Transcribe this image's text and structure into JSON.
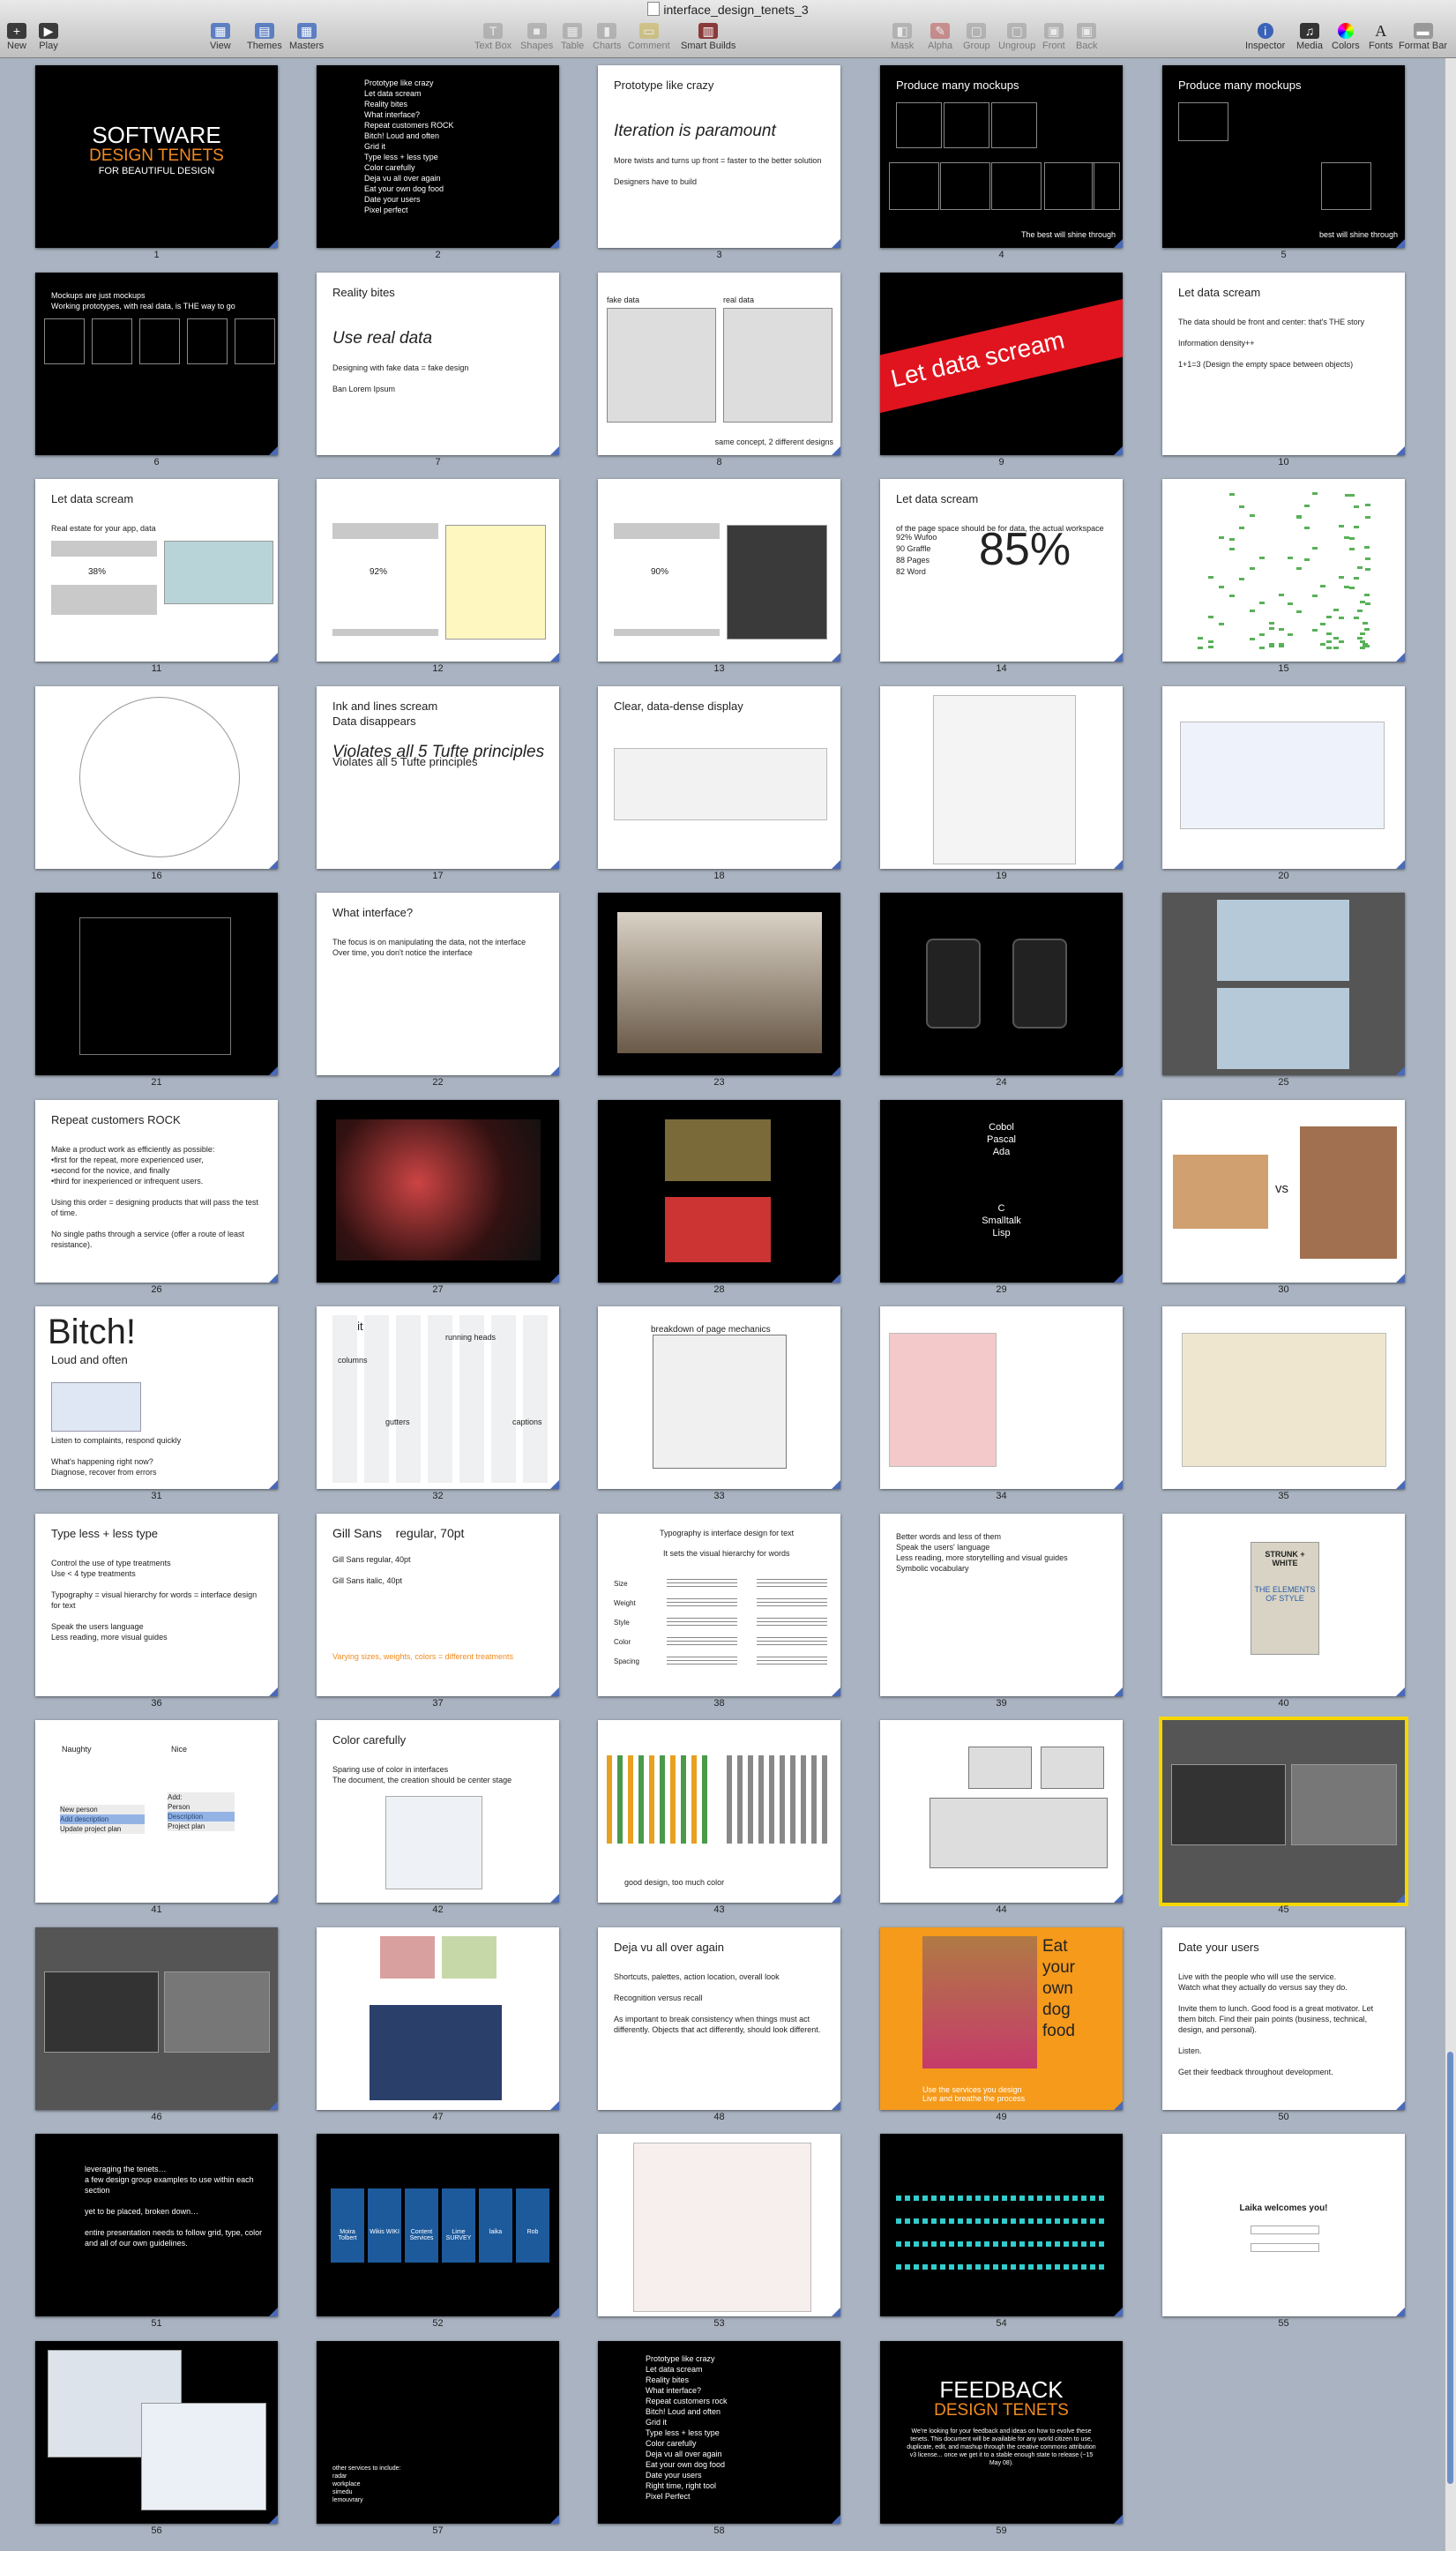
{
  "window": {
    "title": "interface_design_tenets_3"
  },
  "toolbar": {
    "new": "New",
    "play": "Play",
    "view": "View",
    "themes": "Themes",
    "masters": "Masters",
    "text_box": "Text Box",
    "shapes": "Shapes",
    "table": "Table",
    "charts": "Charts",
    "comment": "Comment",
    "smart_builds": "Smart Builds",
    "mask": "Mask",
    "alpha": "Alpha",
    "group": "Group",
    "ungroup": "Ungroup",
    "front": "Front",
    "back": "Back",
    "inspector": "Inspector",
    "media": "Media",
    "colors": "Colors",
    "fonts": "Fonts",
    "format_bar": "Format Bar"
  },
  "slides": [
    {
      "n": "1",
      "bg": "black",
      "big1": "SOFTWARE",
      "big2": "DESIGN TENETS",
      "sub": "FOR BEAUTIFUL DESIGN",
      "accent": "#f08a20"
    },
    {
      "n": "2",
      "bg": "black",
      "text": "Prototype like crazy\nLet data scream\nReality bites\nWhat interface?\nRepeat customers ROCK\nBitch! Loud and often\nGrid it\nType less + less type\nColor carefully\nDeja vu all over again\nEat your own dog food\nDate your users\nPixel perfect"
    },
    {
      "n": "3",
      "bg": "white",
      "title": "Prototype like crazy",
      "big": "Iteration is paramount",
      "text": "More twists and turns up front = faster to the better solution\n\nDesigners have to build"
    },
    {
      "n": "4",
      "bg": "black",
      "title": "Produce many mockups",
      "foot": "The best will shine through"
    },
    {
      "n": "5",
      "bg": "black",
      "title": "Produce many mockups",
      "foot": "best will shine through"
    },
    {
      "n": "6",
      "bg": "black",
      "text": "Mockups are just mockups\nWorking prototypes, with real data, is THE way to go"
    },
    {
      "n": "7",
      "bg": "white",
      "title": "Reality bites",
      "big": "Use real data",
      "text": "Designing with fake data = fake design\n\nBan Lorem Ipsum"
    },
    {
      "n": "8",
      "bg": "white",
      "l1": "fake data",
      "l2": "real data",
      "foot": "same concept, 2 different designs"
    },
    {
      "n": "9",
      "bg": "black",
      "banner": "Let data scream",
      "accent": "#e0141e"
    },
    {
      "n": "10",
      "bg": "white",
      "title": "Let data scream",
      "text": "The data should be front and center: that's THE story\n\nInformation density++\n\n1+1=3 (Design the empty space between objects)"
    },
    {
      "n": "11",
      "bg": "white",
      "title": "Let data scream",
      "text": "Real estate for your app, data",
      "pct": "38%"
    },
    {
      "n": "12",
      "bg": "white",
      "pct": "92%"
    },
    {
      "n": "13",
      "bg": "white",
      "pct": "90%"
    },
    {
      "n": "14",
      "bg": "white",
      "title": "Let data scream",
      "list": "92%  Wufoo\n90  Graffle\n88  Pages\n82  Word",
      "huge": "85%",
      "text": "of the page space should be for data, the actual workspace"
    },
    {
      "n": "15",
      "bg": "white"
    },
    {
      "n": "16",
      "bg": "white"
    },
    {
      "n": "17",
      "bg": "white",
      "title": "Ink and lines scream\nData disappears",
      "big": "Violates all 5 Tufte principles"
    },
    {
      "n": "18",
      "bg": "white",
      "title": "Clear, data-dense display"
    },
    {
      "n": "19",
      "bg": "white"
    },
    {
      "n": "20",
      "bg": "white"
    },
    {
      "n": "21",
      "bg": "black"
    },
    {
      "n": "22",
      "bg": "white",
      "title": "What interface?",
      "text": "The focus is on manipulating the data, not the interface\nOver time, you don't notice the interface"
    },
    {
      "n": "23",
      "bg": "black"
    },
    {
      "n": "24",
      "bg": "black"
    },
    {
      "n": "25",
      "bg": "gray"
    },
    {
      "n": "26",
      "bg": "white",
      "title": "Repeat customers ROCK",
      "text": "Make a product work as efficiently as possible:\n•first for the repeat, more experienced user,\n•second for the novice, and finally\n•third for inexperienced or infrequent users.\n\nUsing this order = designing products that will pass the test of time.\n\nNo single paths through a service (offer a route of least resistance)."
    },
    {
      "n": "27",
      "bg": "black"
    },
    {
      "n": "28",
      "bg": "black"
    },
    {
      "n": "29",
      "bg": "black",
      "center": "Cobol\nPascal\nAda",
      "center2": "C\nSmalltalk\nLisp"
    },
    {
      "n": "30",
      "bg": "white",
      "vs": "vs"
    },
    {
      "n": "31",
      "bg": "white",
      "huge": "Bitch!",
      "title": "Loud and often",
      "text": "Listen to complaints, respond quickly\n\nWhat's happening right now?\nDiagnose, recover from errors"
    },
    {
      "n": "32",
      "bg": "white",
      "title": "Grid it",
      "l1": "running heads",
      "l2": "columns",
      "l3": "gutters",
      "l4": "captions"
    },
    {
      "n": "33",
      "bg": "white",
      "title": "breakdown of page mechanics"
    },
    {
      "n": "34",
      "bg": "white"
    },
    {
      "n": "35",
      "bg": "white"
    },
    {
      "n": "36",
      "bg": "white",
      "title": "Type less + less type",
      "text": "Control the use of type treatments\nUse < 4 type treatments\n\nTypography = visual hierarchy for words = interface design for text\n\nSpeak the users language\nLess reading, more visual guides"
    },
    {
      "n": "37",
      "bg": "white",
      "title": "Gill Sans    regular, 70pt",
      "text": "Gill Sans    regular, 40pt\n\nGill Sans    italic, 40pt",
      "foot": "Varying sizes, weights, colors = different treatments",
      "accent": "#f08a20"
    },
    {
      "n": "38",
      "bg": "white",
      "title": "Typography is interface design for text",
      "sub": "It sets the visual hierarchy for words",
      "list": "Size\n\nWeight\n\nStyle\n\nColor\n\nSpacing"
    },
    {
      "n": "39",
      "bg": "white",
      "text": "Better words and less of them\nSpeak the users' language\nLess reading, more storytelling and visual guides\nSymbolic vocabulary"
    },
    {
      "n": "40",
      "bg": "white",
      "book1": "STRUNK + WHITE",
      "book2": "THE ELEMENTS OF STYLE"
    },
    {
      "n": "41",
      "bg": "white",
      "l1": "Naughty",
      "l2": "Nice",
      "left": "New person\nAdd description\nUpdate project plan",
      "right": "Add:\nPerson\nDescription\nProject plan"
    },
    {
      "n": "42",
      "bg": "white",
      "title": "Color carefully",
      "text": "Sparing use of color in interfaces\nThe document, the creation should be center stage"
    },
    {
      "n": "43",
      "bg": "white",
      "foot": "good design, too much color"
    },
    {
      "n": "44",
      "bg": "white"
    },
    {
      "n": "45",
      "bg": "gray",
      "selected": true
    },
    {
      "n": "46",
      "bg": "gray"
    },
    {
      "n": "47",
      "bg": "white"
    },
    {
      "n": "48",
      "bg": "white",
      "title": "Deja vu all over again",
      "text": "Shortcuts, palettes, action location, overall look\n\nRecognition versus recall\n\nAs important to break consistency when things must act differently. Objects that act differently, should look different."
    },
    {
      "n": "49",
      "bg": "orange",
      "title": "Eat\nyour\nown\ndog\nfood",
      "foot": "Use the services you design\nLive and breathe the process"
    },
    {
      "n": "50",
      "bg": "white",
      "title": "Date your users",
      "text": "Live with the people who will use the service.\nWatch what they actually do versus say they do.\n\nInvite them to lunch. Good food is a great motivator. Let them bitch. Find their pain points (business, technical, design, and personal).\n\nListen.\n\nGet their feedback throughout development."
    },
    {
      "n": "51",
      "bg": "black",
      "text": "leveraging the tenets…\na few design group examples to use within each section\n\nyet to be placed, broken down…\n\nentire presentation needs to follow grid, type, color and all of our own guidelines."
    },
    {
      "n": "52",
      "bg": "black",
      "tiles": [
        "Moira Tolbert",
        "Wikis WIKI",
        "Content Services",
        "Lime SURVEY",
        "laika",
        "Rob"
      ]
    },
    {
      "n": "53",
      "bg": "white"
    },
    {
      "n": "54",
      "bg": "black"
    },
    {
      "n": "55",
      "bg": "white",
      "title": "Laika welcomes you!"
    },
    {
      "n": "56",
      "bg": "black"
    },
    {
      "n": "57",
      "bg": "black",
      "text": "other services to include:\nradar\nworkplace\nsimedu\nlemouvrary"
    },
    {
      "n": "58",
      "bg": "black",
      "text": "Prototype like crazy\nLet data scream\nReality bites\nWhat interface?\nRepeat customers rock\nBitch! Loud and often\nGrid it\nType less + less type\nColor carefully\nDeja vu all over again\nEat your own dog food\nDate your users\nRight time, right tool\nPixel Perfect"
    },
    {
      "n": "59",
      "bg": "black",
      "big1": "FEEDBACK",
      "big2": "DESIGN TENETS",
      "text": "We're looking for your feedback and ideas on how to evolve these tenets. This document will be available for any world citizen to use, duplicate, edit, and mashup through the creative commons attribution v3 license... once we get it to a stable enough state to release (~15 May 08)."
    }
  ]
}
